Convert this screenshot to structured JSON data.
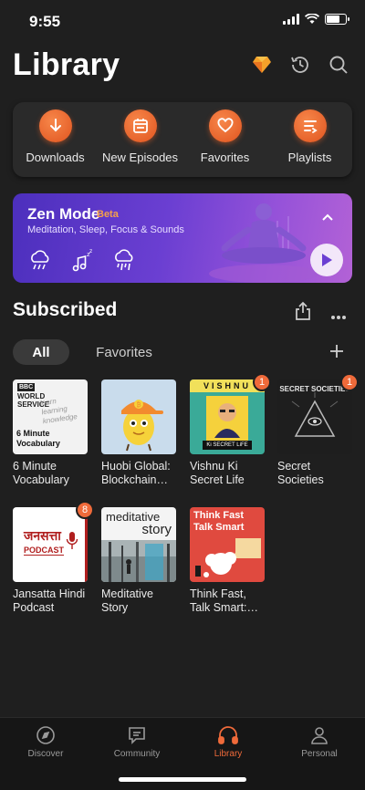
{
  "status": {
    "time": "9:55"
  },
  "header": {
    "title": "Library"
  },
  "quick_actions": [
    {
      "label": "Downloads",
      "icon": "download-icon"
    },
    {
      "label": "New Episodes",
      "icon": "calendar-icon"
    },
    {
      "label": "Favorites",
      "icon": "heart-icon"
    },
    {
      "label": "Playlists",
      "icon": "playlist-icon"
    }
  ],
  "zen": {
    "title": "Zen Mode",
    "badge": "Beta",
    "subtitle": "Meditation, Sleep, Focus & Sounds"
  },
  "subscribed": {
    "title": "Subscribed",
    "tabs": [
      "All",
      "Favorites"
    ]
  },
  "podcasts": [
    {
      "title": "6 Minute Vocabulary",
      "badge": null,
      "cover_text": [
        "BBC",
        "WORLD",
        "SERVICE",
        "6 Minute",
        "Vocabulary"
      ]
    },
    {
      "title": "Huobi Global: Blockchain…",
      "badge": null
    },
    {
      "title": "Vishnu Ki Secret Life",
      "badge": "1",
      "cover_text": [
        "VISHNU",
        "Ki SECRET LiFE"
      ]
    },
    {
      "title": "Secret Societies",
      "badge": "1",
      "cover_text": [
        "SECRET SOCIETIES"
      ]
    },
    {
      "title": "Jansatta Hindi Podcast",
      "badge": "8",
      "cover_text": [
        "जनसत्ता",
        "PODCAST"
      ]
    },
    {
      "title": "Meditative Story",
      "badge": null,
      "cover_text": [
        "meditative",
        "story"
      ]
    },
    {
      "title": "Think Fast, Talk Smart:…",
      "badge": null,
      "cover_text": [
        "Think Fast",
        "Talk Smart"
      ]
    }
  ],
  "nav": [
    {
      "label": "Discover"
    },
    {
      "label": "Community"
    },
    {
      "label": "Library",
      "active": true
    },
    {
      "label": "Personal"
    }
  ],
  "colors": {
    "accent": "#ef6a3a",
    "zen_start": "#4c2fbd",
    "zen_end": "#b362d6"
  }
}
